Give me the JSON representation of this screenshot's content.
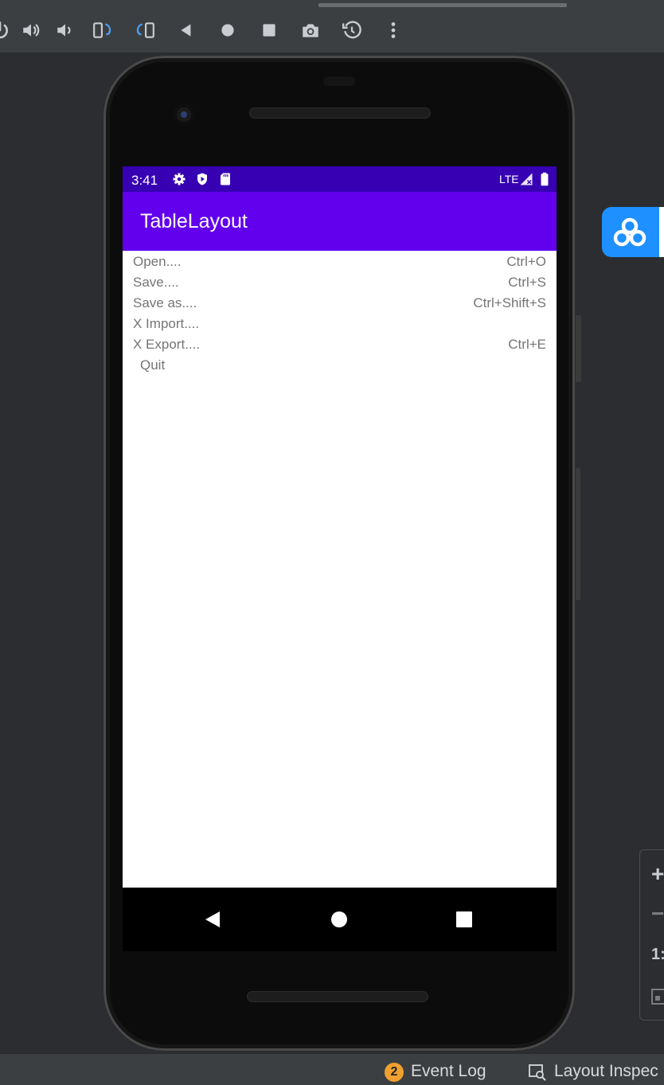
{
  "toolbar": {
    "buttons": [
      "power-icon",
      "volume-up-icon",
      "volume-down-icon",
      "rotate-left-icon",
      "rotate-right-icon",
      "back-icon",
      "home-icon",
      "overview-icon",
      "camera-icon",
      "snapshot-icon",
      "more-icon"
    ]
  },
  "device": {
    "status_bar": {
      "time": "3:41",
      "network": "LTE"
    },
    "app_bar": {
      "title": "TableLayout"
    },
    "menu_rows": [
      {
        "label": "Open....",
        "shortcut": "Ctrl+O"
      },
      {
        "label": "Save....",
        "shortcut": "Ctrl+S"
      },
      {
        "label": "Save as....",
        "shortcut": "Ctrl+Shift+S"
      },
      {
        "label": "X Import....",
        "shortcut": ""
      },
      {
        "label": "X Export....",
        "shortcut": "Ctrl+E"
      },
      {
        "label": "Quit",
        "shortcut": ""
      }
    ]
  },
  "side_panel": {
    "zoom_in": "+",
    "zoom_out": "−",
    "ratio": "1:"
  },
  "bottom_bar": {
    "event_count": "2",
    "event_log": "Event Log",
    "layout_inspector": "Layout Inspec"
  },
  "colors": {
    "status_bar": "#3700b3",
    "app_bar": "#6200ee",
    "cloud": "#1e90ff",
    "badge": "#f0a030"
  }
}
